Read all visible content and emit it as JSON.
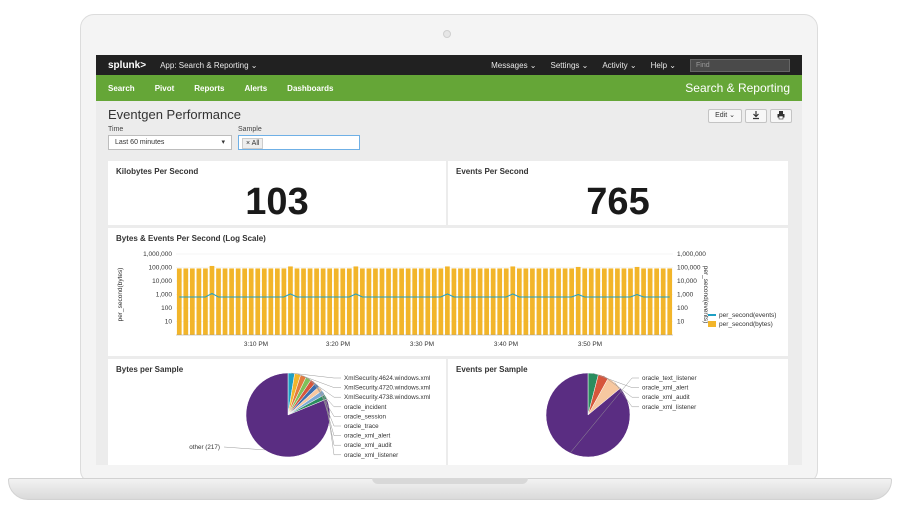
{
  "topbar": {
    "logo": "splunk>",
    "app_menu": "App: Search & Reporting ⌄",
    "menus": [
      "Messages ⌄",
      "Settings ⌄",
      "Activity ⌄",
      "Help ⌄"
    ],
    "find_placeholder": "Find"
  },
  "nav": {
    "items": [
      "Search",
      "Pivot",
      "Reports",
      "Alerts",
      "Dashboards"
    ],
    "app_title": "Search & Reporting"
  },
  "dashboard": {
    "title": "Eventgen Performance",
    "edit_label": "Edit ⌄",
    "export_icon": "download-icon",
    "print_icon": "print-icon",
    "time_label": "Time",
    "time_value": "Last 60 minutes",
    "sample_label": "Sample",
    "sample_tag": "× All"
  },
  "panels": {
    "kbps_title": "Kilobytes Per Second",
    "kbps_value": "103",
    "eps_title": "Events Per Second",
    "eps_value": "765",
    "chart_title": "Bytes & Events Per Second (Log Scale)",
    "bytes_sample_title": "Bytes per Sample",
    "events_sample_title": "Events per Sample"
  },
  "colors": {
    "green": "#65a637",
    "bytes_series": "#f2b52a",
    "events_series": "#1ea0c4",
    "pie_main": "#5a2d82"
  },
  "chart_data": [
    {
      "type": "bar",
      "title": "Bytes & Events Per Second (Log Scale)",
      "ylabel": "per_second(bytes)",
      "y2label": "per_second(events)",
      "yscale": "log",
      "ylim": [
        1,
        1000000
      ],
      "yticks": [
        "1,000,000",
        "100,000",
        "10,000",
        "1,000",
        "100",
        "10"
      ],
      "xticks": [
        "3:10 PM",
        "3:20 PM",
        "3:30 PM",
        "3:40 PM",
        "3:50 PM"
      ],
      "legend": [
        "per_second(events)",
        "per_second(bytes)"
      ],
      "legend_position": "right",
      "series": [
        {
          "name": "per_second(bytes)",
          "type": "bar",
          "values": [
            85000,
            85000,
            85000,
            85000,
            85000,
            130000,
            85000,
            85000,
            85000,
            85000,
            85000,
            85000,
            85000,
            85000,
            85000,
            85000,
            85000,
            120000,
            85000,
            85000,
            85000,
            85000,
            85000,
            85000,
            85000,
            85000,
            85000,
            120000,
            85000,
            85000,
            85000,
            85000,
            85000,
            85000,
            85000,
            85000,
            85000,
            85000,
            85000,
            85000,
            85000,
            120000,
            85000,
            85000,
            85000,
            85000,
            85000,
            85000,
            85000,
            85000,
            85000,
            120000,
            85000,
            85000,
            85000,
            85000,
            85000,
            85000,
            85000,
            85000,
            85000,
            110000,
            85000,
            85000,
            85000,
            85000,
            85000,
            85000,
            85000,
            85000,
            110000,
            85000,
            85000,
            85000,
            85000,
            85000
          ]
        },
        {
          "name": "per_second(events)",
          "type": "line",
          "values": [
            650,
            650,
            650,
            650,
            650,
            1200,
            650,
            650,
            650,
            650,
            650,
            650,
            650,
            650,
            650,
            650,
            650,
            1100,
            650,
            650,
            650,
            650,
            650,
            650,
            650,
            650,
            650,
            1100,
            650,
            650,
            650,
            650,
            650,
            650,
            650,
            650,
            650,
            650,
            650,
            650,
            650,
            1100,
            650,
            650,
            650,
            650,
            650,
            650,
            650,
            650,
            650,
            1100,
            650,
            650,
            650,
            650,
            650,
            650,
            650,
            650,
            650,
            1000,
            650,
            650,
            650,
            650,
            650,
            650,
            650,
            650,
            1000,
            650,
            650,
            650,
            650,
            650
          ]
        }
      ]
    },
    {
      "type": "pie",
      "title": "Bytes per Sample",
      "categories": [
        "other (217)",
        "XmlSecurity.4624.windows.xml",
        "XmlSecurity.4720.windows.xml",
        "XmlSecurity.4738.windows.xml",
        "oracle_incident",
        "oracle_session",
        "oracle_trace",
        "oracle_xml_alert",
        "oracle_xml_audit",
        "oracle_xml_listener"
      ],
      "values": [
        80,
        2.5,
        2.3,
        2.2,
        2.1,
        2.0,
        1.9,
        1.9,
        1.8,
        1.8
      ],
      "colors": [
        "#5a2d82",
        "#1ea0c4",
        "#f2b52a",
        "#e37b3e",
        "#7fc15a",
        "#d6563c",
        "#3d6fb0",
        "#f7c8a0",
        "#7aa8d6",
        "#2a8d5f"
      ]
    },
    {
      "type": "pie",
      "title": "Events per Sample",
      "categories": [
        "oracle_text_listener",
        "oracle_xml_alert",
        "oracle_xml_audit",
        "oracle_xml_listener"
      ],
      "values": [
        86,
        4,
        4,
        6
      ],
      "colors": [
        "#5a2d82",
        "#2a8d5f",
        "#d6563c",
        "#f7c8a0"
      ]
    }
  ]
}
